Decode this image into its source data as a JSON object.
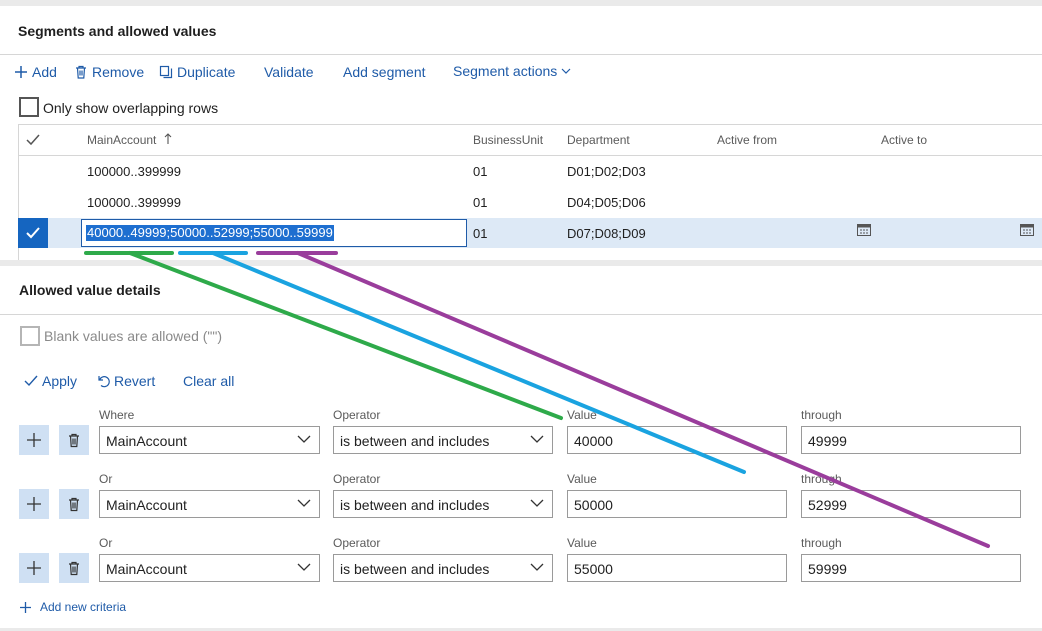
{
  "segments": {
    "title": "Segments and allowed values",
    "toolbar": {
      "add": "Add",
      "remove": "Remove",
      "duplicate": "Duplicate",
      "validate": "Validate",
      "add_segment": "Add segment",
      "segment_actions": "Segment actions"
    },
    "overlap_label": "Only show overlapping rows",
    "columns": [
      "MainAccount",
      "BusinessUnit",
      "Department",
      "Active from",
      "Active to"
    ],
    "rows": [
      {
        "main": "100000..399999",
        "bu": "01",
        "dept": "D01;D02;D03"
      },
      {
        "main": "100000..399999",
        "bu": "01",
        "dept": "D04;D05;D06"
      },
      {
        "main": "40000..49999;50000..52999;55000..59999",
        "bu": "01",
        "dept": "D07;D08;D09"
      }
    ]
  },
  "details": {
    "title": "Allowed value details",
    "blank_label": "Blank values are allowed (\"\")",
    "toolbar": {
      "apply": "Apply",
      "revert": "Revert",
      "clear_all": "Clear all"
    },
    "criteria": [
      {
        "where_label": "Where",
        "field": "MainAccount",
        "operator_label": "Operator",
        "operator": "is between and includes",
        "value_label": "Value",
        "value": "40000",
        "through_label": "through",
        "through": "49999"
      },
      {
        "where_label": "Or",
        "field": "MainAccount",
        "operator_label": "Operator",
        "operator": "is between and includes",
        "value_label": "Value",
        "value": "50000",
        "through_label": "through",
        "through": "52999"
      },
      {
        "where_label": "Or",
        "field": "MainAccount",
        "operator_label": "Operator",
        "operator": "is between and includes",
        "value_label": "Value",
        "value": "55000",
        "through_label": "through",
        "through": "59999"
      }
    ],
    "add_criteria": "Add new criteria"
  },
  "annotation_colors": {
    "first": "#2eaa4a",
    "second": "#1aa3e0",
    "third": "#9a3d9c"
  }
}
